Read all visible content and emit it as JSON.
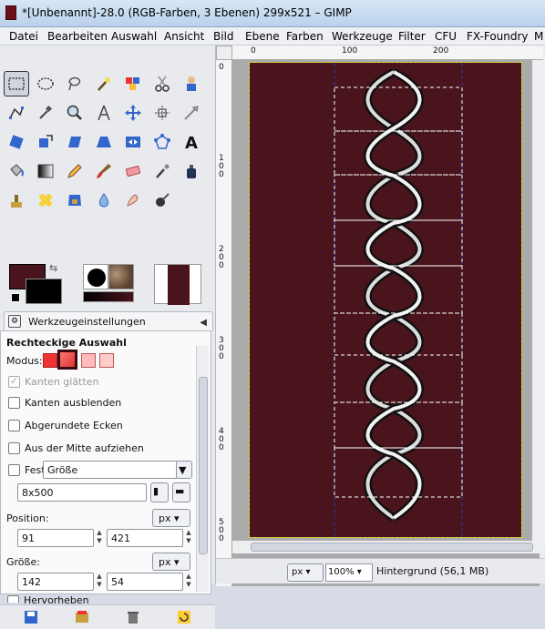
{
  "window": {
    "title": "*[Unbenannt]-28.0 (RGB-Farben, 3 Ebenen) 299x521 – GIMP"
  },
  "menu": [
    "Datei",
    "Bearbeiten",
    "Auswahl",
    "Ansicht",
    "Bild",
    "Ebene",
    "Farben",
    "Werkzeuge",
    "Filter",
    "CFU",
    "FX-Foundry",
    "M"
  ],
  "tool_options": {
    "tab_label": "Werkzeugeinstellungen",
    "tool_name": "Rechteckige Auswahl",
    "mode_label": "Modus:",
    "antialias_label": "Kanten glätten",
    "feather_label": "Kanten ausblenden",
    "rounded_label": "Abgerundete Ecken",
    "center_label": "Aus der Mitte aufziehen",
    "fixed_label": "Fest",
    "fixed_value": "Größe",
    "fixed_text": "8x500",
    "position_label": "Position:",
    "position_unit": "px",
    "pos_x": "91",
    "pos_y": "421",
    "size_label": "Größe:",
    "size_unit": "px",
    "size_w": "142",
    "size_h": "54",
    "highlight_label": "Hervorheben"
  },
  "rulers": {
    "h": [
      "0",
      "100",
      "200"
    ],
    "v": [
      "0",
      "100",
      "200",
      "300",
      "400",
      "500"
    ]
  },
  "status": {
    "unit": "px",
    "zoom": "100%",
    "text": "Hintergrund (56,1 MB)"
  },
  "colors": {
    "foreground": "#4a141d",
    "background": "#000000",
    "canvas": "#4a141d"
  }
}
